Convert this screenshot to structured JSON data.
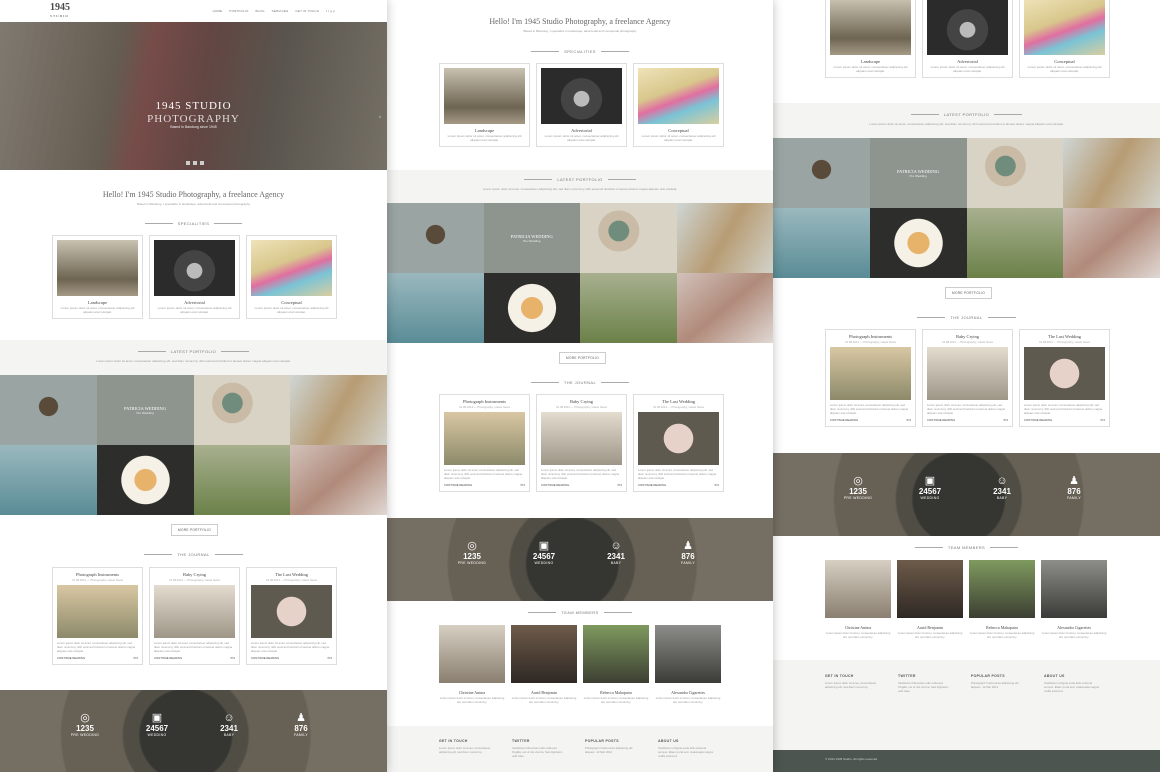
{
  "brand": {
    "name": "1945",
    "tag": "STUDIO"
  },
  "nav": [
    "HOME",
    "PORTFOLIO",
    "BLOG",
    "SERVICES",
    "GET IN TOUCH"
  ],
  "hero": {
    "title": "1945 STUDIO",
    "subtitle": "PHOTOGRAPHY",
    "caption": "Based in Bandung since 1945"
  },
  "intro": {
    "title": "Hello! I'm 1945 Studio Photography, a freelance Agency",
    "subtitle": "Based in Bandung, I specialize in landscape, advertorial and conceptual photography"
  },
  "specialities": {
    "heading": "SPECIALITIES",
    "items": [
      {
        "title": "Landscape",
        "text": "Lorem ipsum dolor sit amet, consectetuer adipiscing elit aliquam erat volutpat."
      },
      {
        "title": "Advertorial",
        "text": "Lorem ipsum dolor sit amet, consectetuer adipiscing elit aliquam erat volutpat."
      },
      {
        "title": "Conceptual",
        "text": "Lorem ipsum dolor sit amet, consectetuer adipiscing elit aliquam erat volutpat."
      }
    ]
  },
  "portfolio": {
    "heading": "LATEST PORTFOLIO",
    "subtitle": "Lorem ipsum dolor sit amet, consectetuer adipiscing elit, sed diam nonummy nibh euismod tincidunt ut laoreet dolore magna aliquam erat volutpat.",
    "highlight": {
      "title": "PATRICIA WEDDING",
      "sub": "Pre Wedding"
    },
    "button": "MORE PORTFOLIO"
  },
  "journal": {
    "heading": "THE JOURNAL",
    "read_more": "CONTINUE READING",
    "comments": "0",
    "posts": [
      {
        "title": "Photograph Instruments",
        "meta": "01.08.2014 — Photography, Latest News",
        "text": "Lorem ipsum dolor sit amet, consectetuer adipiscing elit, sed diam nonummy nibh euismod tincidunt ut laoreet dolore magna aliquam erat volutpat."
      },
      {
        "title": "Baby Crying",
        "meta": "01.08.2014 — Photography, Latest News",
        "text": "Lorem ipsum dolor sit amet, consectetuer adipiscing elit, sed diam nonummy nibh euismod tincidunt ut laoreet dolore magna aliquam erat volutpat."
      },
      {
        "title": "The Last Wedding",
        "meta": "01.08.2014 — Photography, Latest News",
        "text": "Lorem ipsum dolor sit amet, consectetuer adipiscing elit, sed diam nonummy nibh euismod tincidunt ut laoreet dolore magna aliquam erat volutpat."
      }
    ]
  },
  "stats": [
    {
      "icon": "rings-icon",
      "glyph": "◎",
      "value": "1235",
      "label": "PRE WEDDING"
    },
    {
      "icon": "calendar-icon",
      "glyph": "▣",
      "value": "24567",
      "label": "WEDDING"
    },
    {
      "icon": "baby-icon",
      "glyph": "☺",
      "value": "2341",
      "label": "BABY"
    },
    {
      "icon": "family-icon",
      "glyph": "♟",
      "value": "876",
      "label": "FAMILY"
    }
  ],
  "team": {
    "heading": "TEAM MEMBERS",
    "members": [
      {
        "name": "Christine Anima",
        "text": "Lorem ipsum dolor sit amet, consectetuer adipiscing elit, sed diam nonummy."
      },
      {
        "name": "Aurid Benjamin",
        "text": "Lorem ipsum dolor sit amet, consectetuer adipiscing elit, sed diam nonummy."
      },
      {
        "name": "Rebecca Mahapatra",
        "text": "Lorem ipsum dolor sit amet, consectetuer adipiscing elit, sed diam nonummy."
      },
      {
        "name": "Alexandra Cigarettes",
        "text": "Lorem ipsum dolor sit amet, consectetuer adipiscing elit, sed diam nonummy."
      }
    ]
  },
  "footer": {
    "cols": [
      {
        "title": "GET IN TOUCH",
        "text": "Lorem ipsum dolor sit amet, consectetuer adipiscing elit, sed diam nonummy."
      },
      {
        "title": "TWITTER",
        "text": "Vestibulum bibendum odio nulla sed fringilla, est ut nisi viverra. Sed dignissim velit vitae."
      },
      {
        "title": "POPULAR POSTS",
        "text": "Photograph Instruments adipiscing elit aliquam. 12 Mar 2014"
      },
      {
        "title": "ABOUT US",
        "text": "Vestibulum id ligula porta felis euismod semper. Etiam porta sem malesuada magna mollis euismod."
      }
    ],
    "copyright": "© 2014 1945 Studio. All rights reserved"
  }
}
